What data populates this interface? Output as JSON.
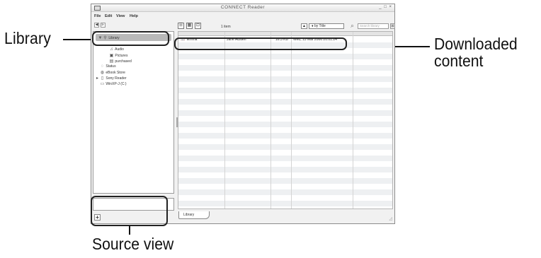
{
  "window": {
    "title": "CONNECT Reader",
    "controls": "_ □ ×"
  },
  "menu": {
    "file": "File",
    "edit": "Edit",
    "view": "View",
    "help": "Help"
  },
  "toolbar": {
    "back": "◀",
    "forward": "▶",
    "view_list": "☰",
    "view_grid": "▦",
    "view_cover": "⊡",
    "item_count": "1 item",
    "sort_order": "▲",
    "sort_by": "♦ by Title",
    "search_placeholder": "Search library",
    "search_clear": "⊠"
  },
  "sidebar": {
    "library": "Library",
    "items": [
      {
        "label": "Audio",
        "icon": "music-note-icon"
      },
      {
        "label": "Pictures",
        "icon": "picture-icon"
      },
      {
        "label": "purchased",
        "icon": "list-icon"
      },
      {
        "label": "Status",
        "icon": "status-icon"
      },
      {
        "label": "eBook Store",
        "icon": "globe-icon"
      },
      {
        "label": "Sony Reader",
        "icon": "device-icon"
      },
      {
        "label": "WinXP-J (C:)",
        "icon": "drive-icon"
      }
    ],
    "add_button": "+"
  },
  "content": {
    "rows": [
      {
        "title": "Emma",
        "author": "Jane Austen",
        "size": "16.3 KB",
        "date": "Wed, 15 Mar 2006 20:01:24"
      }
    ],
    "tab_label": "Library"
  },
  "callouts": {
    "library": "Library",
    "downloaded_line1": "Downloaded",
    "downloaded_line2": "content",
    "source_view": "Source view"
  }
}
